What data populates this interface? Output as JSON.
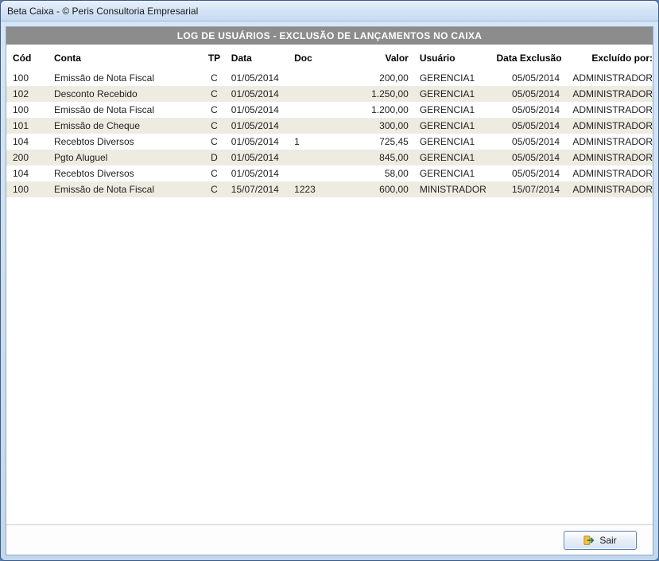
{
  "window": {
    "title": "Beta Caixa - © Peris Consultoria Empresarial"
  },
  "banner": {
    "title": "LOG DE USUÁRIOS - EXCLUSÃO DE LANÇAMENTOS NO CAIXA"
  },
  "columns": {
    "cod": "Cód",
    "conta": "Conta",
    "tp": "TP",
    "data": "Data",
    "doc": "Doc",
    "valor": "Valor",
    "usuario": "Usuário",
    "dataex": "Data Exclusão",
    "excpor": "Excluído por:"
  },
  "rows": [
    {
      "cod": "100",
      "conta": "Emissão de Nota Fiscal",
      "tp": "C",
      "data": "01/05/2014",
      "doc": "",
      "valor": "200,00",
      "usuario": "GERENCIA1",
      "dataex": "05/05/2014",
      "excpor": "ADMINISTRADOR"
    },
    {
      "cod": "102",
      "conta": "Desconto Recebido",
      "tp": "C",
      "data": "01/05/2014",
      "doc": "",
      "valor": "1.250,00",
      "usuario": "GERENCIA1",
      "dataex": "05/05/2014",
      "excpor": "ADMINISTRADOR"
    },
    {
      "cod": "100",
      "conta": "Emissão de Nota Fiscal",
      "tp": "C",
      "data": "01/05/2014",
      "doc": "",
      "valor": "1.200,00",
      "usuario": "GERENCIA1",
      "dataex": "05/05/2014",
      "excpor": "ADMINISTRADOR"
    },
    {
      "cod": "101",
      "conta": "Emissão de Cheque",
      "tp": "C",
      "data": "01/05/2014",
      "doc": "",
      "valor": "300,00",
      "usuario": "GERENCIA1",
      "dataex": "05/05/2014",
      "excpor": "ADMINISTRADOR"
    },
    {
      "cod": "104",
      "conta": "Recebtos Diversos",
      "tp": "C",
      "data": "01/05/2014",
      "doc": "1",
      "valor": "725,45",
      "usuario": "GERENCIA1",
      "dataex": "05/05/2014",
      "excpor": "ADMINISTRADOR"
    },
    {
      "cod": "200",
      "conta": "Pgto Aluguel",
      "tp": "D",
      "data": "01/05/2014",
      "doc": "",
      "valor": "845,00",
      "usuario": "GERENCIA1",
      "dataex": "05/05/2014",
      "excpor": "ADMINISTRADOR"
    },
    {
      "cod": "104",
      "conta": "Recebtos Diversos",
      "tp": "C",
      "data": "01/05/2014",
      "doc": "",
      "valor": "58,00",
      "usuario": "GERENCIA1",
      "dataex": "05/05/2014",
      "excpor": "ADMINISTRADOR"
    },
    {
      "cod": "100",
      "conta": "Emissão de Nota Fiscal",
      "tp": "C",
      "data": "15/07/2014",
      "doc": "1223",
      "valor": "600,00",
      "usuario": "MINISTRADOR",
      "dataex": "15/07/2014",
      "excpor": "ADMINISTRADOR"
    }
  ],
  "footer": {
    "exit_label": "Sair"
  }
}
